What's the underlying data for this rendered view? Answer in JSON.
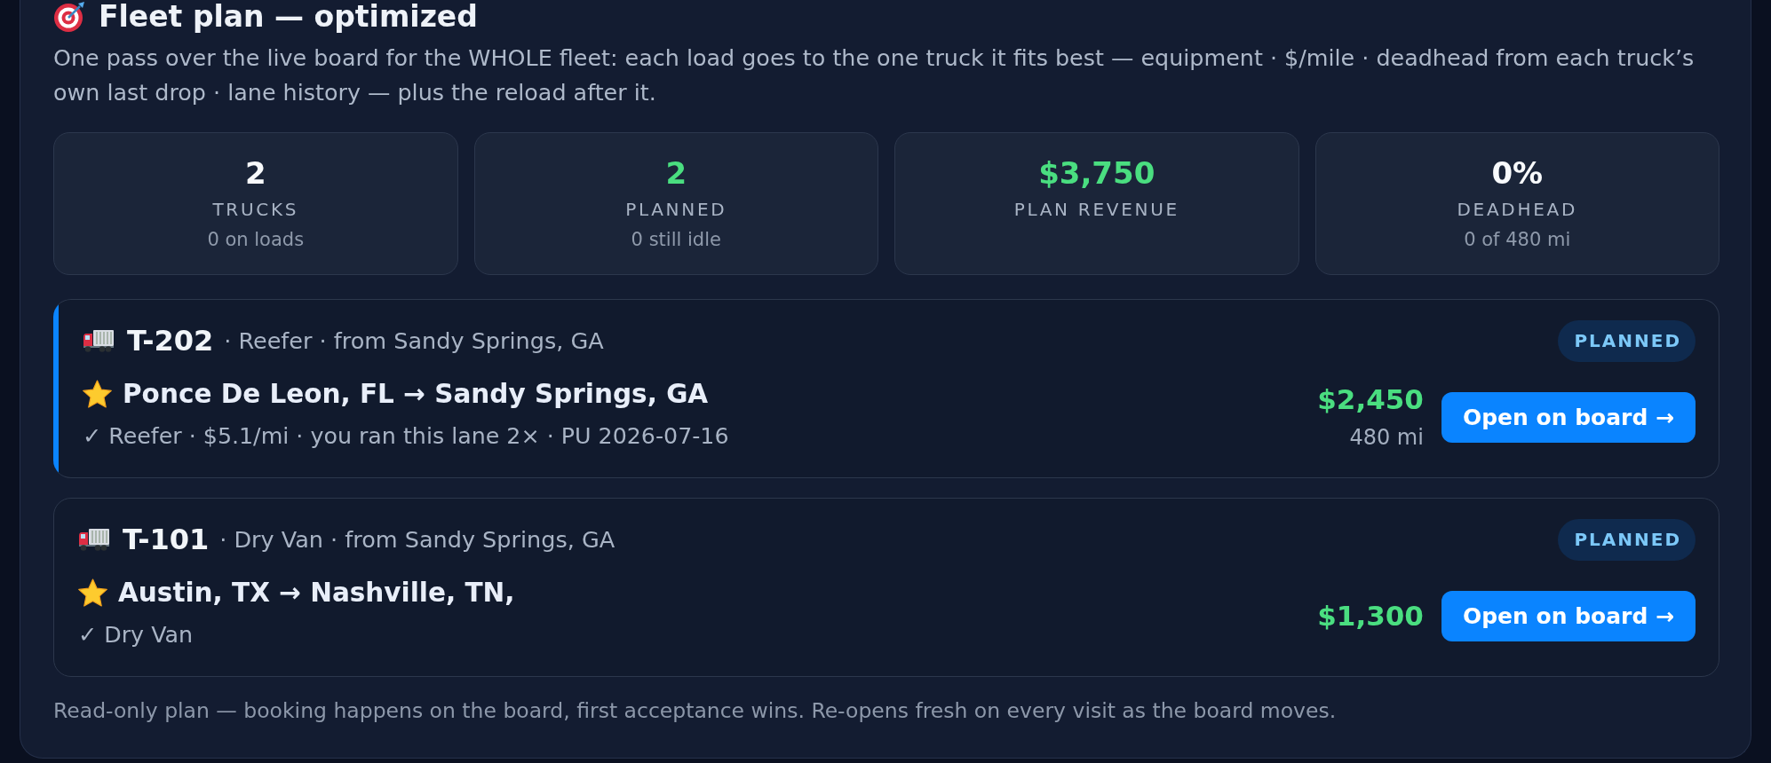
{
  "panel": {
    "title": "Fleet plan — optimized",
    "description": "One pass over the live board for the WHOLE fleet: each load goes to the one truck it fits best — equipment · $/mile · deadhead from each truck’s own last drop · lane history — plus the reload after it."
  },
  "stats": [
    {
      "value": "2",
      "label": "TRUCKS",
      "sub": "0 on loads",
      "color": "#f8fafc"
    },
    {
      "value": "2",
      "label": "PLANNED",
      "sub": "0 still idle",
      "color": "#4ade80"
    },
    {
      "value": "$3,750",
      "label": "PLAN REVENUE",
      "color": "#4ade80"
    },
    {
      "value": "0%",
      "label": "DEADHEAD",
      "sub": "0 of 480 mi",
      "color": "#f8fafc"
    }
  ],
  "plans": [
    {
      "truck": "T-202",
      "meta": "· Reefer · from Sandy Springs, GA",
      "route": "Ponce De Leon, FL → Sandy Springs, GA",
      "details": "✓ Reefer · $5.1/mi · you ran this lane 2× · PU 2026-07-16",
      "status": "PLANNED",
      "price": "$2,450",
      "miles": "480 mi",
      "action": "Open on board →",
      "selected": true
    },
    {
      "truck": "T-101",
      "meta": "· Dry Van · from Sandy Springs, GA",
      "route": "Austin, TX → Nashville, TN,",
      "details": "✓ Dry Van",
      "status": "PLANNED",
      "price": "$1,300",
      "action": "Open on board →",
      "selected": false
    }
  ],
  "footer": "Read-only plan — booking happens on the board, first acceptance wins. Re-opens fresh on every visit as the board moves."
}
